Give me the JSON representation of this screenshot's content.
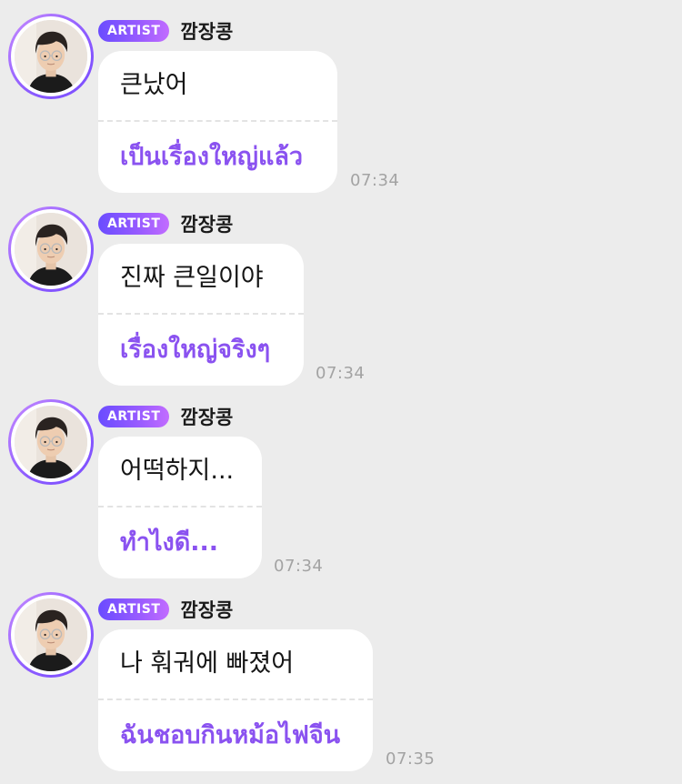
{
  "messages": [
    {
      "badge": "ARTIST",
      "sender": "깜장콩",
      "text": "큰났어",
      "translation": "เป็นเรื่องใหญ่แล้ว",
      "time": "07:34"
    },
    {
      "badge": "ARTIST",
      "sender": "깜장콩",
      "text": "진짜 큰일이야",
      "translation": "เรื่องใหญ่จริงๆ",
      "time": "07:34"
    },
    {
      "badge": "ARTIST",
      "sender": "깜장콩",
      "text": "어떡하지...",
      "translation": "ทำไงดี...",
      "time": "07:34"
    },
    {
      "badge": "ARTIST",
      "sender": "깜장콩",
      "text": "나 훠궈에 빠졌어",
      "translation": "ฉันชอบกินหม้อไฟจีน",
      "time": "07:35"
    }
  ],
  "colors": {
    "background": "#ececec",
    "bubble": "#ffffff",
    "translation_text": "#8a52f0",
    "badge_gradient_start": "#6a4cff",
    "badge_gradient_end": "#c26cff",
    "timestamp": "#a3a3a3"
  },
  "icons": {
    "avatar": "profile-photo-person-with-glasses"
  }
}
